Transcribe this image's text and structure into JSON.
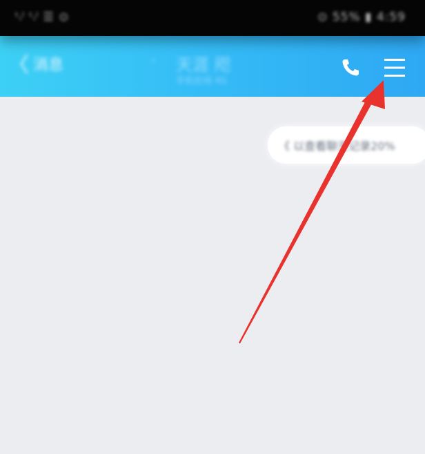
{
  "status_bar": {
    "left_text": "ᵗᵢˡ ᵗᵢˡ ☰ ⊙",
    "right_text": "⊙ 55% ▮ 4:59"
  },
  "header": {
    "back_chevron": "〈",
    "back_label": "消息",
    "title_dot": "·",
    "title": "天涯 咫",
    "subtitle": "手机在线 4G",
    "phone_icon": "phone-icon",
    "menu_icon": "menu-icon",
    "gradient_start": "#3dd0f5",
    "gradient_end": "#2ea8f3"
  },
  "chat": {
    "background": "#ebedf1",
    "notice": "《 以查看聊天记录20%"
  },
  "annotation": {
    "color": "#e8322d",
    "icon": "red-arrow"
  }
}
